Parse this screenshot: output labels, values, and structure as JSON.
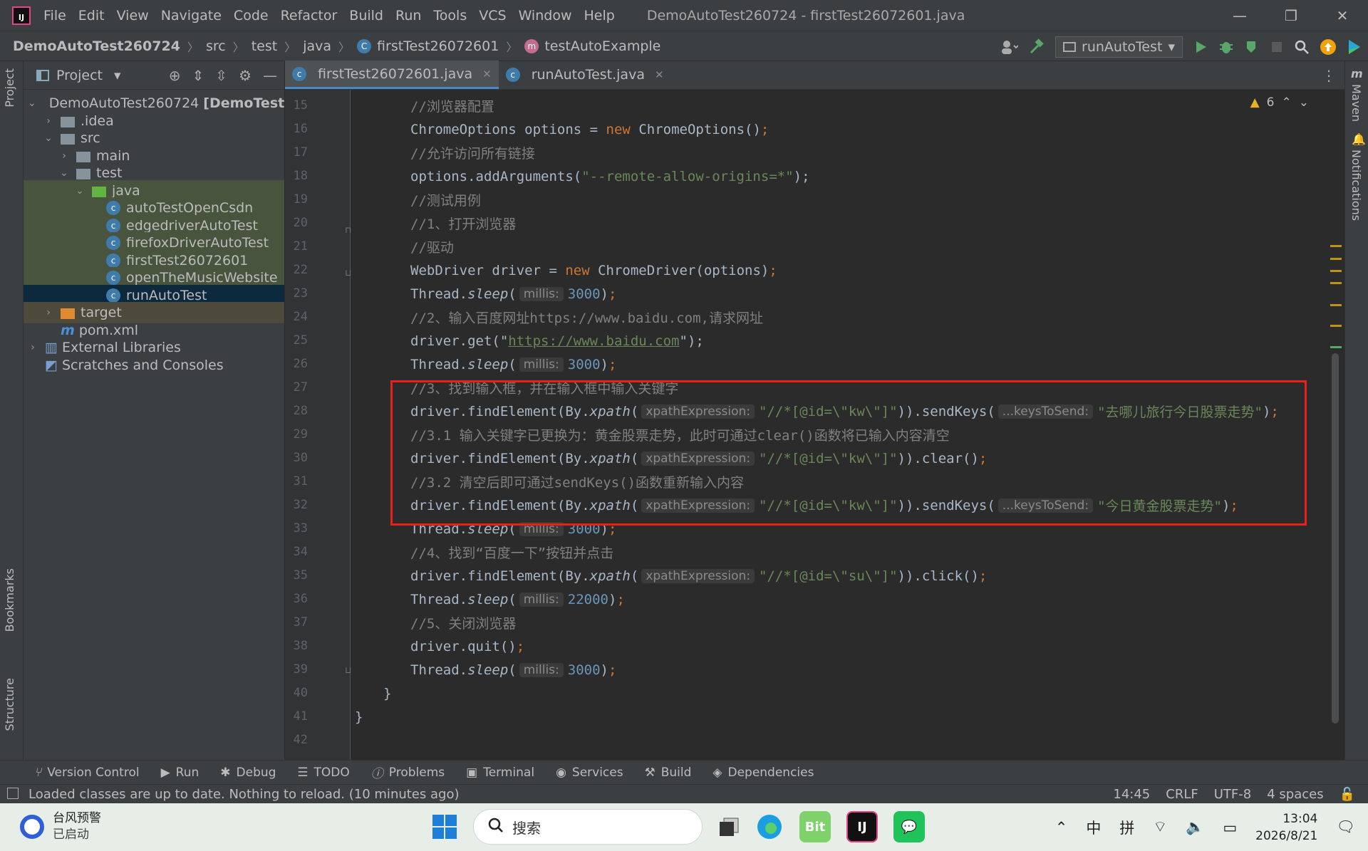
{
  "menubar": {
    "logo": "IJ",
    "items": [
      "File",
      "Edit",
      "View",
      "Navigate",
      "Code",
      "Refactor",
      "Build",
      "Run",
      "Tools",
      "VCS",
      "Window",
      "Help"
    ],
    "title": "DemoAutoTest260724 - firstTest26072601.java",
    "controls": {
      "minimize": "—",
      "restore": "❐",
      "close": "✕"
    }
  },
  "navbar": {
    "crumbs": [
      "DemoAutoTest260724",
      "src",
      "test",
      "java",
      "firstTest26072601",
      "testAutoExample"
    ],
    "run_config": "runAutoTest"
  },
  "left_stripe": {
    "project": "Project",
    "bookmarks": "Bookmarks",
    "structure": "Structure"
  },
  "project": {
    "title": "Project",
    "tree": [
      {
        "label": "DemoAutoTest260724",
        "suffix": "[DemoTest2"
      },
      {
        "label": ".idea"
      },
      {
        "label": "src"
      },
      {
        "label": "main"
      },
      {
        "label": "test"
      },
      {
        "label": "java"
      },
      {
        "label": "autoTestOpenCsdn"
      },
      {
        "label": "edgedriverAutoTest"
      },
      {
        "label": "firefoxDriverAutoTest"
      },
      {
        "label": "firstTest26072601"
      },
      {
        "label": "openTheMusicWebsite"
      },
      {
        "label": "runAutoTest"
      },
      {
        "label": "target"
      },
      {
        "label": "pom.xml"
      },
      {
        "label": "External Libraries"
      },
      {
        "label": "Scratches and Consoles"
      }
    ]
  },
  "editor": {
    "tabs": [
      "firstTest26072601.java",
      "runAutoTest.java"
    ],
    "inspection_count": "6",
    "line_numbers": [
      "15",
      "16",
      "17",
      "18",
      "19",
      "20",
      "21",
      "22",
      "23",
      "24",
      "25",
      "26",
      "27",
      "28",
      "29",
      "30",
      "31",
      "32",
      "33",
      "34",
      "35",
      "36",
      "37",
      "38",
      "39",
      "40",
      "41",
      "42"
    ],
    "code": {
      "l15": "//浏览器配置",
      "l16a": "ChromeOptions options = ",
      "l16b": "new",
      "l16c": " ChromeOptions()",
      "l17": "//允许访问所有链接",
      "l18a": "options.addArguments(",
      "l18b": "\"--remote-allow-origins=*\"",
      "l18c": ");",
      "l19": "//测试用例",
      "l20": "//1、打开浏览器",
      "l21": "//驱动",
      "l22a": "WebDriver driver = ",
      "l22b": "new",
      "l22c": " ChromeDriver(options)",
      "thread": "Thread.",
      "sleep": "sleep",
      "millis": "millis:",
      "l23n": "3000",
      "l24": "//2、输入百度网址https://www.baidu.com,请求网址",
      "l25a": "driver.get(\"",
      "l25b": "https://www.baidu.com",
      "l25c": "\");",
      "l26n": "3000",
      "l27": "//3、找到输入框，并在输入框中输入关键字",
      "find": "driver.findElement(By.",
      "xpath": "xpath",
      "xpe": "xpathExpression:",
      "kw_str": "\"//*[@id=\\\"kw\\\"]\"",
      "send": ")).sendKeys(",
      "kts": "...keysToSend:",
      "l28s": "\"去哪儿旅行今日股票走势\"",
      "l29": "//3.1 输入关键字已更换为：黄金股票走势，此时可通过clear()函数将已输入内容清空",
      "clear": ")).clear()",
      "l31": "//3.2 清空后即可通过sendKeys()函数重新输入内容",
      "l32s": "\"今日黄金股票走势\"",
      "l33n": "3000",
      "l34": "//4、找到“百度一下”按钮并点击",
      "su_str": "\"//*[@id=\\\"su\\\"]\"",
      "click": ")).click()",
      "l36n": "22000",
      "l37": "//5、关闭浏览器",
      "l38": "driver.quit()",
      "l39n": "3000",
      "close_inner": "}",
      "close_outer": "}"
    }
  },
  "right_stripe": {
    "maven": "Maven",
    "notifications": "Notifications"
  },
  "tool_windows": [
    "Version Control",
    "Run",
    "Debug",
    "TODO",
    "Problems",
    "Terminal",
    "Services",
    "Build",
    "Dependencies"
  ],
  "status": {
    "message": "Loaded classes are up to date. Nothing to reload. (10 minutes ago)",
    "position": "14:45",
    "line_sep": "CRLF",
    "encoding": "UTF-8",
    "indent": "4 spaces"
  },
  "taskbar": {
    "weather_title": "台风预警",
    "weather_sub": "已启动",
    "search_placeholder": "搜索",
    "ime_lang": "中",
    "ime_mode": "拼",
    "time": "13:04",
    "date": "2026/8/21"
  }
}
